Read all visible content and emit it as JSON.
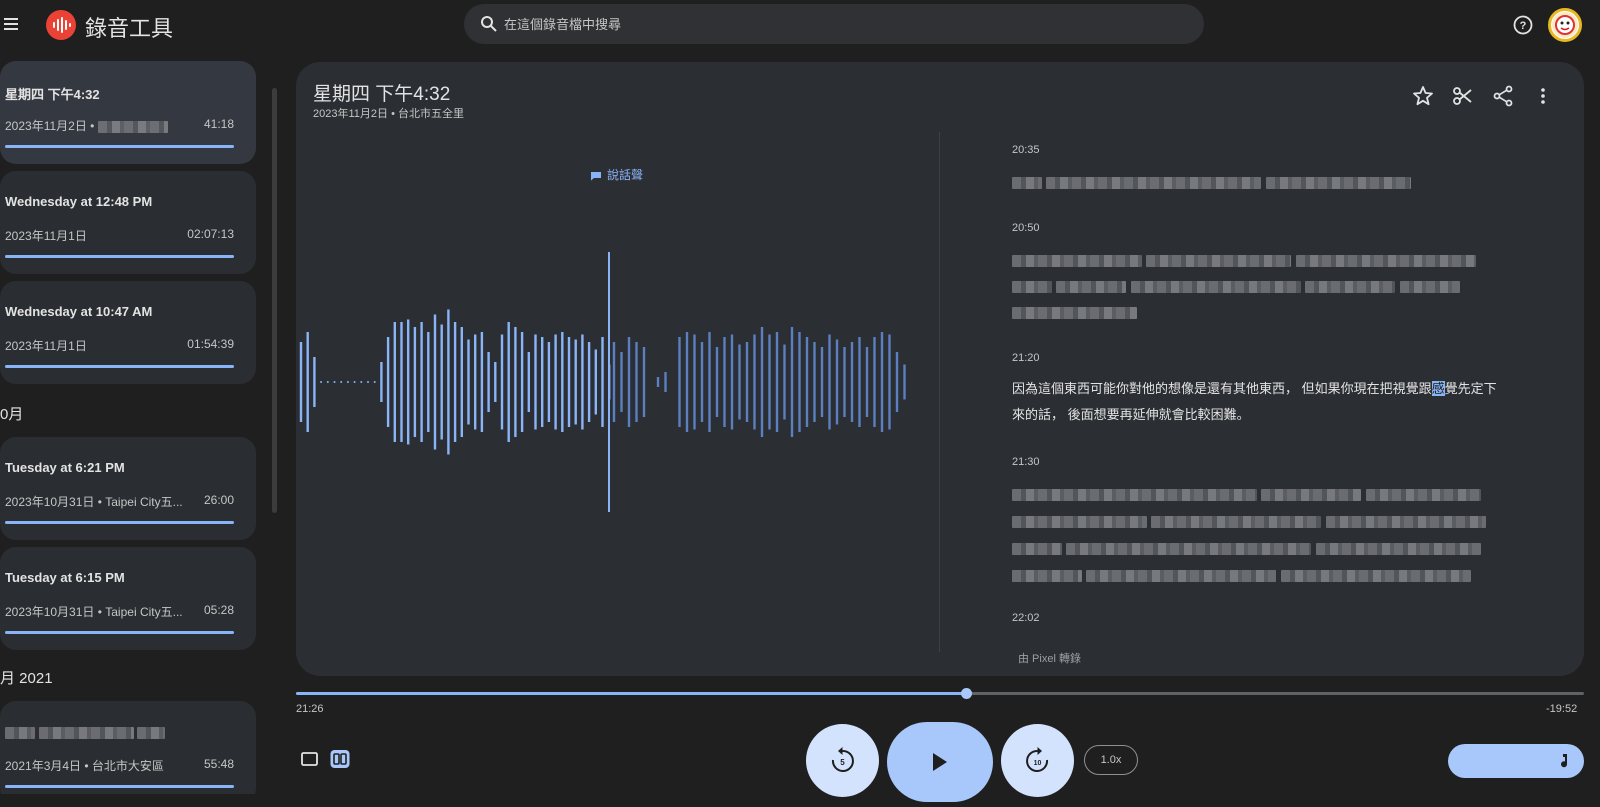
{
  "app": {
    "title": "錄音工具",
    "search_placeholder": "在這個錄音檔中搜尋"
  },
  "sidebar": {
    "recordings": [
      {
        "title": "星期四 下午4:32",
        "meta": "2023年11月2日 •",
        "duration": "41:18",
        "progress": 1.0
      },
      {
        "title": "Wednesday at 12:48 PM",
        "meta": "2023年11月1日",
        "duration": "02:07:13",
        "progress": 1.0
      },
      {
        "title": "Wednesday at 10:47 AM",
        "meta": "2023年11月1日",
        "duration": "01:54:39",
        "progress": 1.0
      }
    ],
    "section_oct": "0月",
    "recordings_oct": [
      {
        "title": "Tuesday at 6:21 PM",
        "meta": "2023年10月31日 • Taipei City五...",
        "duration": "26:00",
        "progress": 1.0
      },
      {
        "title": "Tuesday at 6:15 PM",
        "meta": "2023年10月31日 • Taipei City五...",
        "duration": "05:28",
        "progress": 1.0
      }
    ],
    "section_2021": "月 2021",
    "recordings_2021": [
      {
        "title": "",
        "meta": "2021年3月4日 • 台北市大安區",
        "duration": "55:48",
        "progress": 1.0
      }
    ]
  },
  "main": {
    "title": "星期四 下午4:32",
    "subtitle": "2023年11月2日 • 台北市五全里",
    "speaker_label": "說話聲",
    "transcript": [
      {
        "time": "20:35"
      },
      {
        "time": "20:50"
      },
      {
        "time": "21:20",
        "text_before": "因為這個東西可能你對他的想像是還有其他東西， 但如果你現在把視覺跟",
        "text_highlight": "感",
        "text_after": "覺先定下來的話， 後面想要再延伸就會比較困難。"
      },
      {
        "time": "21:30"
      },
      {
        "time": "22:02"
      }
    ],
    "transcribed_by": "由 Pixel 轉錄"
  },
  "player": {
    "elapsed": "21:26",
    "remaining": "-19:52",
    "progress_fraction": 0.52,
    "speed": "1.0x",
    "rewind_label": "5",
    "forward_label": "10"
  },
  "icons": {
    "menu": "menu-icon",
    "logo": "recorder-logo-icon",
    "search": "search-icon",
    "help": "help-icon",
    "star": "star-icon",
    "scissors": "scissors-icon",
    "share": "share-icon",
    "more": "more-vert-icon",
    "play": "play-icon",
    "music": "music-note-icon"
  },
  "colors": {
    "accent": "#8ab4f8",
    "background": "#1f1f1f",
    "card": "#2b2e33"
  }
}
